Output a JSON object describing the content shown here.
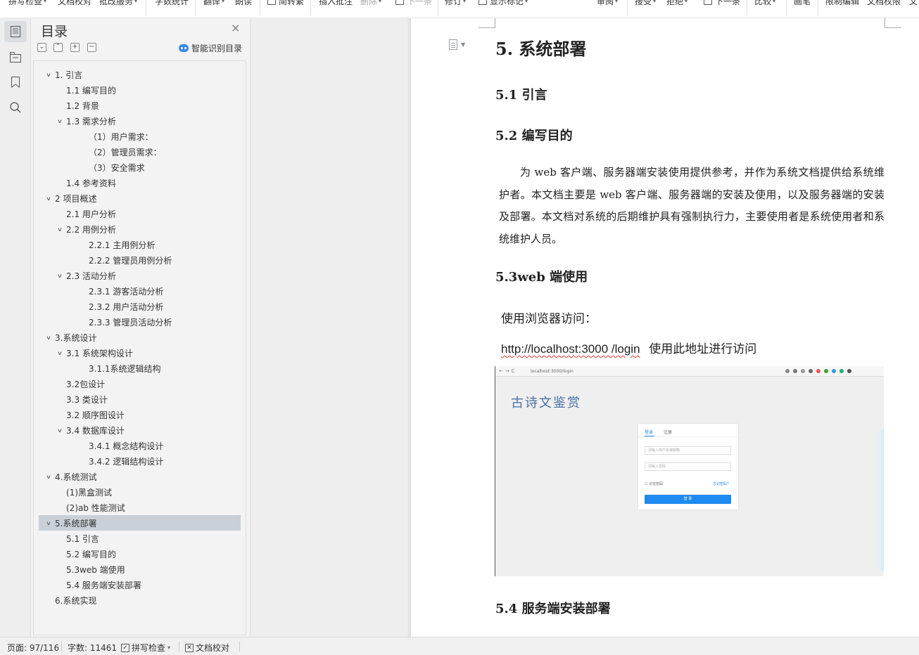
{
  "toolbar": {
    "items": [
      {
        "label": "拼写检查",
        "caret": true
      },
      {
        "label": "文档校对",
        "caret": false
      },
      {
        "label": "批改服务",
        "caret": true
      },
      {
        "label": "字数统计",
        "caret": false
      },
      {
        "label": "翻译",
        "caret": true
      },
      {
        "label": "朗读",
        "caret": false
      },
      {
        "label": "简转繁",
        "caret": false
      },
      {
        "label": "插入批注",
        "caret": false
      },
      {
        "label": "删除",
        "caret": true
      },
      {
        "label": "下一条",
        "caret": false
      },
      {
        "label": "修订",
        "caret": true
      },
      {
        "label": "显示标记",
        "caret": true
      },
      {
        "label": "审阅",
        "caret": true
      },
      {
        "label": "接受",
        "caret": true
      },
      {
        "label": "拒绝",
        "caret": true
      },
      {
        "label": "下一条",
        "caret": false
      },
      {
        "label": "比较",
        "caret": true
      },
      {
        "label": "画笔",
        "caret": false
      },
      {
        "label": "限制编辑",
        "caret": false
      },
      {
        "label": "文档权限",
        "caret": false
      },
      {
        "label": "文",
        "caret": false
      }
    ]
  },
  "nav": {
    "title": "目录",
    "smart_label": "智能识别目录",
    "toc": [
      {
        "label": "1. 引言",
        "level": 1,
        "expanded": true
      },
      {
        "label": "1.1 编写目的",
        "level": 2
      },
      {
        "label": "1.2 背景",
        "level": 2
      },
      {
        "label": "1.3 需求分析",
        "level": 2,
        "expanded": true
      },
      {
        "label": "（1）用户需求：",
        "level": 3
      },
      {
        "label": "（2）管理员需求：",
        "level": 3
      },
      {
        "label": "（3）安全需求",
        "level": 3
      },
      {
        "label": "1.4 参考资料",
        "level": 2
      },
      {
        "label": "2 项目概述",
        "level": 1,
        "expanded": true
      },
      {
        "label": "2.1  用户分析",
        "level": 2
      },
      {
        "label": "2.2  用例分析",
        "level": 2,
        "expanded": true
      },
      {
        "label": "2.2.1  主用例分析",
        "level": 3
      },
      {
        "label": "2.2.2  管理员用例分析",
        "level": 3
      },
      {
        "label": "2.3  活动分析",
        "level": 2,
        "expanded": true
      },
      {
        "label": "2.3.1  游客活动分析",
        "level": 3
      },
      {
        "label": "2.3.2  用户活动分析",
        "level": 3
      },
      {
        "label": "2.3.3  管理员活动分析",
        "level": 3
      },
      {
        "label": "3.系统设计",
        "level": 1,
        "expanded": true
      },
      {
        "label": "3.1  系统架构设计",
        "level": 2,
        "expanded": true
      },
      {
        "label": "3.1.1系统逻辑结构",
        "level": 3
      },
      {
        "label": "3.2包设计",
        "level": 2
      },
      {
        "label": "3.3 类设计",
        "level": 2
      },
      {
        "label": "3.2 顺序图设计",
        "level": 2
      },
      {
        "label": "3.4  数据库设计",
        "level": 2,
        "expanded": true
      },
      {
        "label": "3.4.1  概念结构设计",
        "level": 3
      },
      {
        "label": "3.4.2 逻辑结构设计",
        "level": 3
      },
      {
        "label": "4.系统测试",
        "level": 1,
        "expanded": true
      },
      {
        "label": "(1)黑盒测试",
        "level": 2
      },
      {
        "label": "(2)ab 性能测试",
        "level": 2
      },
      {
        "label": "5.系统部署",
        "level": 1,
        "expanded": true,
        "selected": true
      },
      {
        "label": "5.1 引言",
        "level": 2
      },
      {
        "label": "5.2 编写目的",
        "level": 2
      },
      {
        "label": "5.3web 端使用",
        "level": 2
      },
      {
        "label": "5.4 服务端安装部署",
        "level": 2
      },
      {
        "label": "6.系统实现",
        "level": 1
      }
    ]
  },
  "doc": {
    "h1": "5.  系统部署",
    "h2_intro": "5.1 引言",
    "h2_purpose": "5.2 编写目的",
    "purpose_text": "为 web 客户端、服务器端安装使用提供参考，并作为系统文档提供给系统维护者。本文档主要是 web 客户端、服务器端的安装及使用，以及服务器端的安装及部署。本文档对系统的后期维护具有强制执行力，主要使用者是系统使用者和系统维护人员。",
    "h2_web": "5.3web 端使用",
    "browser_line": "使用浏览器访问：",
    "url": "http://localhost:3000 /login",
    "url_note": "使用此地址进行访问",
    "h2_server": "5.4 服务端安装部署",
    "screenshot": {
      "address": "localhost:3000/login",
      "logo": "古诗文鉴赏",
      "tab_login": "登录",
      "tab_register": "注册",
      "username_placeholder": "请输入用户名或邮箱",
      "password_placeholder": "请输入密码",
      "remember": "记住密码",
      "forgot": "忘记密码?",
      "submit": "登 录"
    }
  },
  "status": {
    "page": "页面: 97/116",
    "words": "字数: 11461",
    "spell": "拼写检查",
    "proofread": "文档校对"
  }
}
